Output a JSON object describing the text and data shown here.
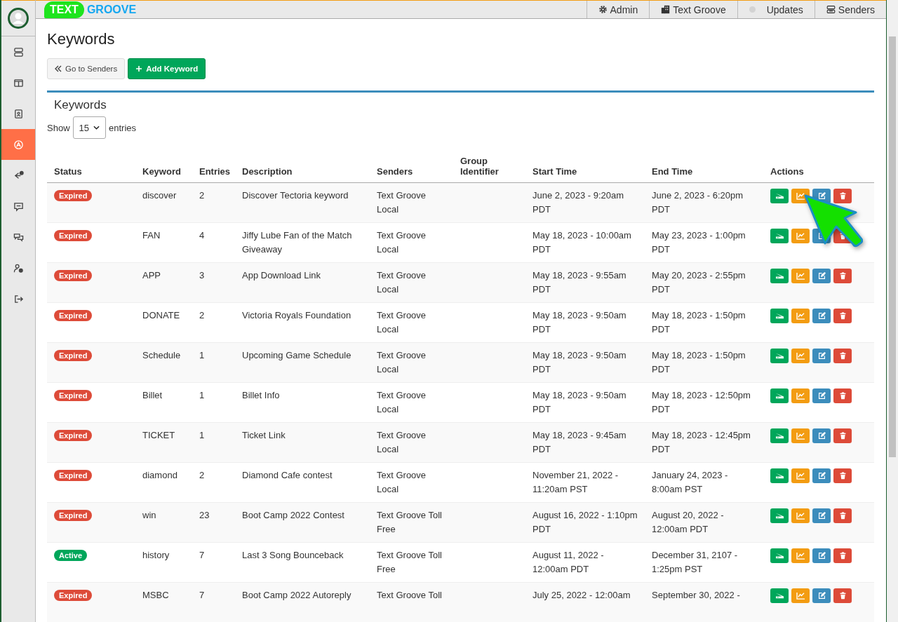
{
  "logo": {
    "badge": "TEXT",
    "word": "GROOVE"
  },
  "sidebar": {
    "items": [
      {
        "selected": false
      },
      {
        "selected": false
      },
      {
        "selected": false
      },
      {
        "selected": true
      },
      {
        "selected": false
      },
      {
        "selected": false
      },
      {
        "selected": false
      },
      {
        "selected": false
      },
      {
        "selected": false
      }
    ]
  },
  "top_nav": [
    {
      "kind": "gear",
      "label": "Admin"
    },
    {
      "kind": "building",
      "label": "Text Groove"
    },
    {
      "kind": "dot",
      "label": "Updates"
    },
    {
      "kind": "inbox",
      "label": "Senders"
    }
  ],
  "page_title": "Keywords",
  "buttons": [
    {
      "kind": "back",
      "label": "Go to Senders"
    },
    {
      "kind": "add",
      "label": "Add Keyword"
    }
  ],
  "panel": {
    "title": "Keywords",
    "length": {
      "before": "Show",
      "value": "15",
      "after": "entries"
    }
  },
  "table": {
    "columns": [
      "Status",
      "Keyword",
      "Entries",
      "Description",
      "Senders",
      "Group Identifier",
      "Start Time",
      "End Time",
      "Actions"
    ],
    "rows": [
      {
        "status": "Expired",
        "active": false,
        "keyword": "discover",
        "entries": "2",
        "description": "Discover Tectoria keyword",
        "senders": "Text Groove Local",
        "start": "June 2, 2023 - 9:20am PDT",
        "end": "June 2, 2023 - 6:20pm PDT"
      },
      {
        "status": "Expired",
        "active": false,
        "keyword": "FAN",
        "entries": "4",
        "description": "Jiffy Lube Fan of the Match Giveaway",
        "senders": "Text Groove Local",
        "start": "May 18, 2023 - 10:00am PDT",
        "end": "May 23, 2023 - 1:00pm PDT"
      },
      {
        "status": "Expired",
        "active": false,
        "keyword": "APP",
        "entries": "3",
        "description": "App Download Link",
        "senders": "Text Groove Local",
        "start": "May 18, 2023 - 9:55am PDT",
        "end": "May 20, 2023 - 2:55pm PDT"
      },
      {
        "status": "Expired",
        "active": false,
        "keyword": "DONATE",
        "entries": "2",
        "description": "Victoria Royals Foundation",
        "senders": "Text Groove Local",
        "start": "May 18, 2023 - 9:50am PDT",
        "end": "May 18, 2023 - 1:50pm PDT"
      },
      {
        "status": "Expired",
        "active": false,
        "keyword": "Schedule",
        "entries": "1",
        "description": "Upcoming Game Schedule",
        "senders": "Text Groove Local",
        "start": "May 18, 2023 - 9:50am PDT",
        "end": "May 18, 2023 - 1:50pm PDT"
      },
      {
        "status": "Expired",
        "active": false,
        "keyword": "Billet",
        "entries": "1",
        "description": "Billet Info",
        "senders": "Text Groove Local",
        "start": "May 18, 2023 - 9:50am PDT",
        "end": "May 18, 2023 - 12:50pm PDT"
      },
      {
        "status": "Expired",
        "active": false,
        "keyword": "TICKET",
        "entries": "1",
        "description": "Ticket Link",
        "senders": "Text Groove Local",
        "start": "May 18, 2023 - 9:45am PDT",
        "end": "May 18, 2023 - 12:45pm PDT"
      },
      {
        "status": "Expired",
        "active": false,
        "keyword": "diamond",
        "entries": "2",
        "description": "Diamond Cafe contest",
        "senders": "Text Groove Local",
        "start": "November 21, 2022 - 11:20am PST",
        "end": "January 24, 2023 - 8:00am PST"
      },
      {
        "status": "Expired",
        "active": false,
        "keyword": "win",
        "entries": "23",
        "description": "Boot Camp 2022 Contest",
        "senders": "Text Groove Toll Free",
        "start": "August 16, 2022 - 1:10pm PDT",
        "end": "August 20, 2022 - 12:00am PDT"
      },
      {
        "status": "Active",
        "active": true,
        "keyword": "history",
        "entries": "7",
        "description": "Last 3 Song Bounceback",
        "senders": "Text Groove Toll Free",
        "start": "August 11, 2022 - 12:00am PDT",
        "end": "December 31, 2107 - 1:25pm PST"
      },
      {
        "status": "Expired",
        "active": false,
        "keyword": "MSBC",
        "entries": "7",
        "description": "Boot Camp 2022 Autoreply",
        "senders": "Text Groove Toll",
        "start": "July 25, 2022 - 12:00am",
        "end": "September 30, 2022 -"
      }
    ]
  }
}
